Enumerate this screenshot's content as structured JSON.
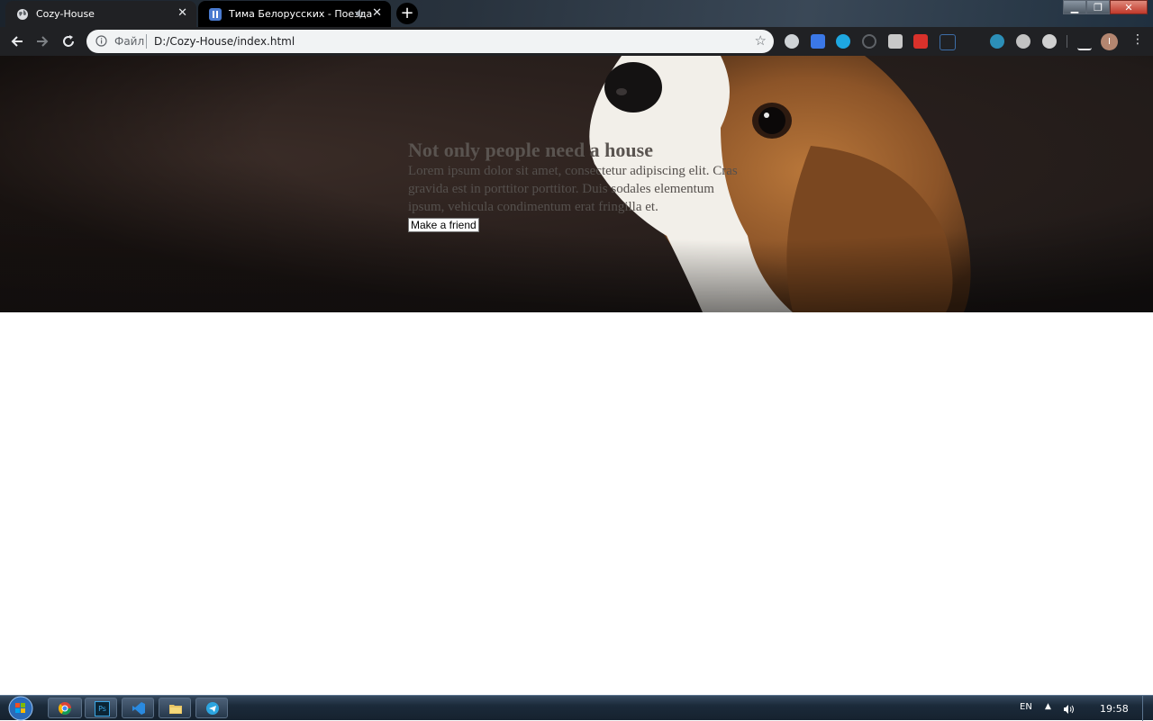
{
  "browser": {
    "tabs": [
      {
        "title": "Cozy-House",
        "icon": "globe-icon",
        "active": true
      },
      {
        "title": "Тима Белорусских - Поезда",
        "icon": "pause-icon",
        "audio": true,
        "active": false
      }
    ],
    "address": {
      "scheme_label": "Файл",
      "url": "D:/Cozy-House/index.html"
    }
  },
  "page": {
    "hero": {
      "title": "Not only people need a house",
      "description": "Lorem ipsum dolor sit amet, consectetur adipiscing elit. Cras gravida est in porttitor porttitor. Duis sodales elementum ipsum, vehicula condimentum erat fringilla et.",
      "button_label": "Make a friend"
    }
  },
  "taskbar": {
    "language": "EN",
    "clock": "19:58"
  },
  "colors": {
    "hero_bg": "#2a201d",
    "hero_text": "#5a5450",
    "chrome_dark": "#202124"
  }
}
